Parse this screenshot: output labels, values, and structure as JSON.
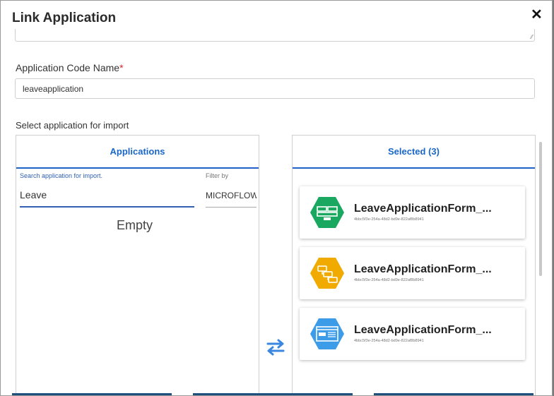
{
  "dialog": {
    "title": "Link Application",
    "close_icon": "close-icon"
  },
  "code_field": {
    "label": "Application Code Name",
    "required_marker": "*",
    "value": "leaveapplication"
  },
  "select_label": "Select application for import",
  "left_panel": {
    "header": "Applications",
    "search_label": "Search application for import.",
    "search_value": "Leave",
    "filter_label": "Filter by",
    "filter_value": "MICROFLOW",
    "empty_text": "Empty"
  },
  "right_panel": {
    "header": "Selected (3)",
    "items": [
      {
        "name": "LeaveApplicationForm_...",
        "id": "4bbc5f3e-254a-48d2-bd9e-822af8b8941",
        "color": "#1aa760",
        "icon": "page-layout-icon"
      },
      {
        "name": "LeaveApplicationForm_...",
        "id": "4bbc5f3e-254a-48d2-bd9e-822af8b8941",
        "color": "#f0aa00",
        "icon": "workflow-icon"
      },
      {
        "name": "LeaveApplicationForm_...",
        "id": "4bbc5f3e-254a-48d2-bd9e-822af8b8941",
        "color": "#3d9ce8",
        "icon": "form-window-icon"
      }
    ]
  },
  "colors": {
    "accent": "#1a67c8",
    "bottom_buttons": "#1d4f7c"
  }
}
